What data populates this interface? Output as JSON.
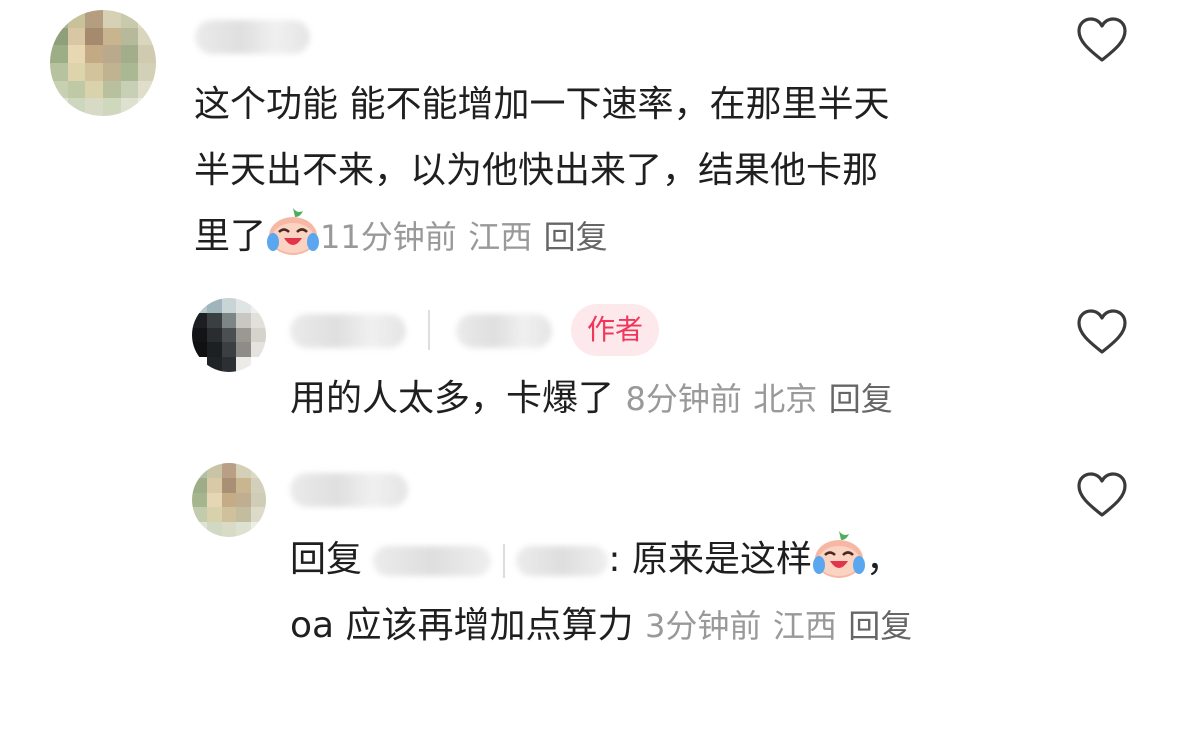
{
  "comments": [
    {
      "text_line1": "这个功能 能不能增加一下速率，在那里半天",
      "text_line2": "半天出不来，以为他快出来了，结果他卡那",
      "text_line3": "里了",
      "time": "11分钟前",
      "location": "江西",
      "reply_label": "回复"
    },
    {
      "badge": "作者",
      "text": "用的人太多，卡爆了",
      "time": "8分钟前",
      "location": "北京",
      "reply_label": "回复"
    },
    {
      "reply_prefix": "回复",
      "text_after_mention": ": 原来是这样",
      "text_tail": "，",
      "text_line2": "oa 应该再增加点算力",
      "time": "3分钟前",
      "location": "江西",
      "reply_label": "回复"
    }
  ],
  "icons": {
    "like": "heart-outline-icon",
    "emoji": "crying-laughing-emoji-icon"
  },
  "colors": {
    "badge_text": "#f0365a",
    "badge_bg": "#fde8ec",
    "meta": "#999999"
  }
}
